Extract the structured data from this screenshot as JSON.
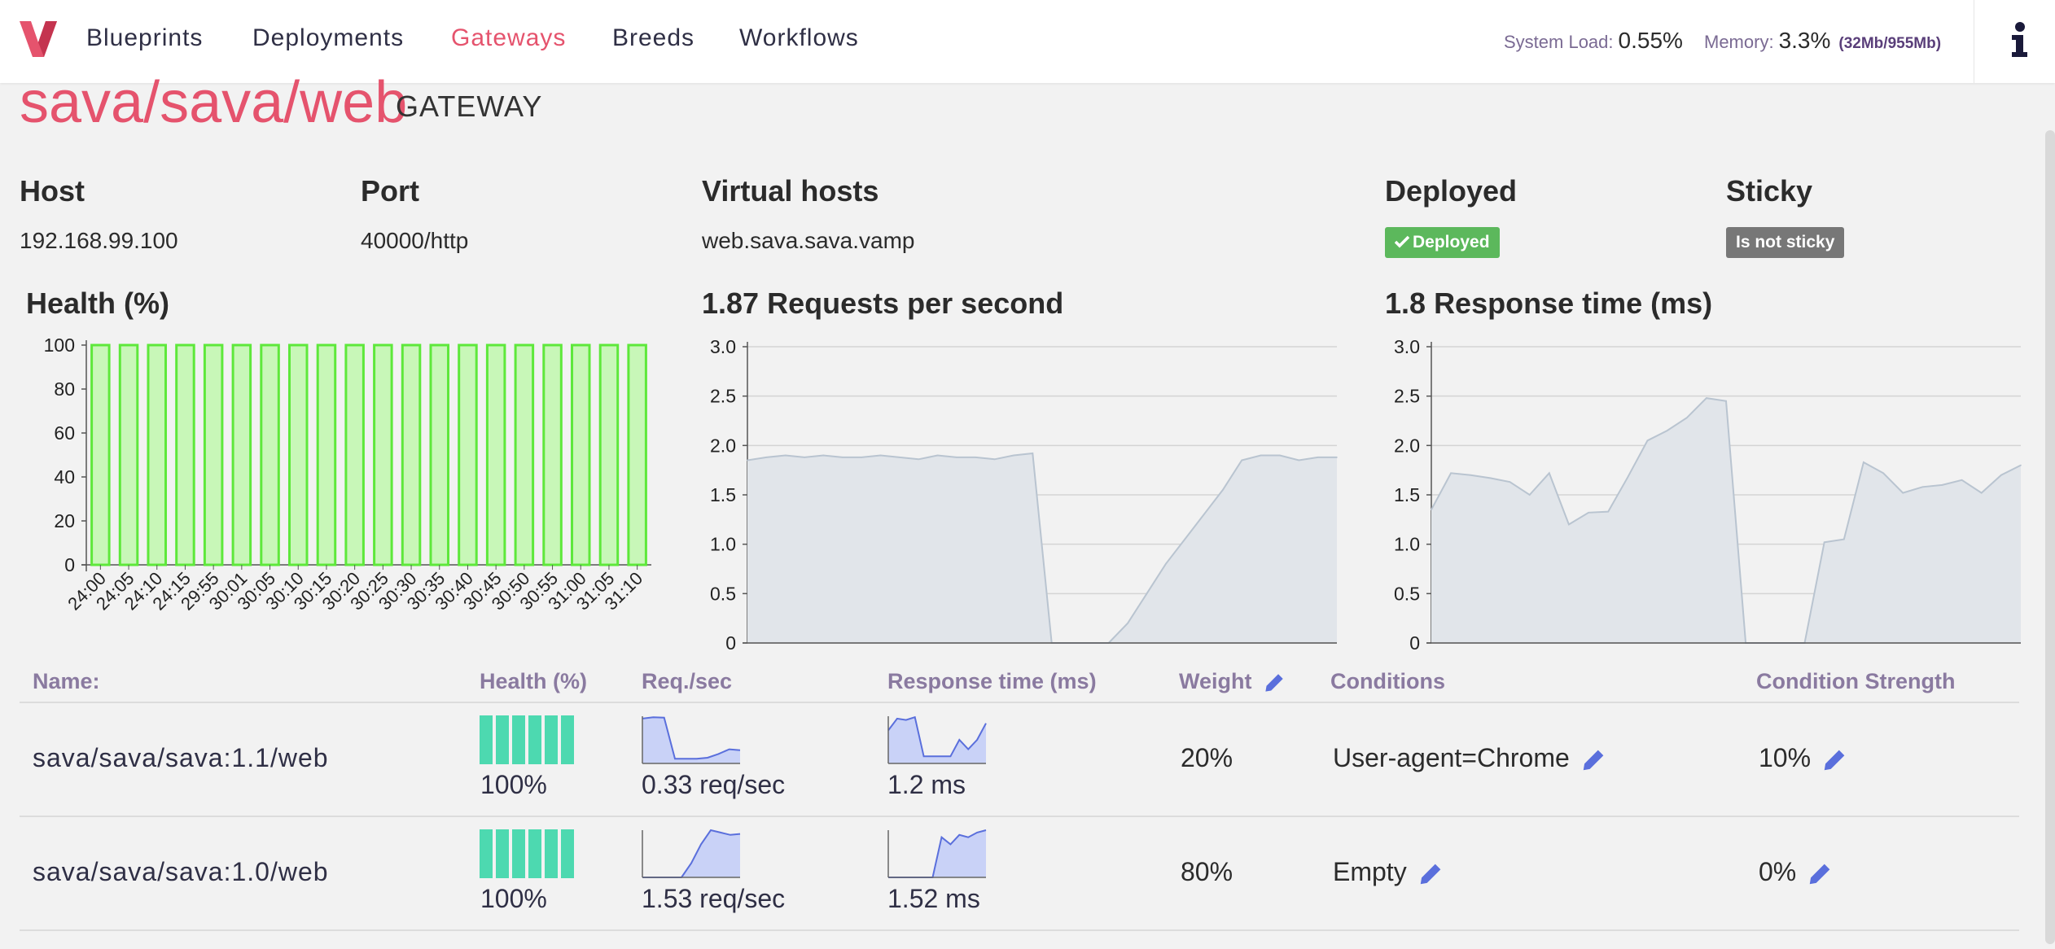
{
  "nav": {
    "items": [
      {
        "label": "Blueprints",
        "active": false
      },
      {
        "label": "Deployments",
        "active": false
      },
      {
        "label": "Gateways",
        "active": true
      },
      {
        "label": "Breeds",
        "active": false
      },
      {
        "label": "Workflows",
        "active": false
      }
    ],
    "system_load_label": "System Load:",
    "system_load_value": "0.55%",
    "memory_label": "Memory:",
    "memory_value": "3.3%",
    "memory_detail": "(32Mb/955Mb)",
    "icons": {
      "logo": "vamp-logo-icon",
      "info": "info-icon"
    },
    "accent_color": "#e5536d"
  },
  "page": {
    "title": "sava/sava/web",
    "subtitle": "GATEWAY"
  },
  "info": {
    "host_label": "Host",
    "host_value": "192.168.99.100",
    "port_label": "Port",
    "port_value": "40000/http",
    "virtual_hosts_label": "Virtual hosts",
    "virtual_hosts_value": "web.sava.sava.vamp",
    "deployed_label": "Deployed",
    "deployed_badge": "Deployed",
    "sticky_label": "Sticky",
    "sticky_badge": "Is not sticky",
    "badge_colors": {
      "deployed": "#5cb85c",
      "sticky": "#777777"
    }
  },
  "chart_data": [
    {
      "type": "bar",
      "title": "Health (%)",
      "categories": [
        "24:00",
        "24:05",
        "24:10",
        "24:15",
        "29:55",
        "30:01",
        "30:05",
        "30:10",
        "30:15",
        "30:20",
        "30:25",
        "30:30",
        "30:35",
        "30:40",
        "30:45",
        "30:50",
        "30:55",
        "31:00",
        "31:05",
        "31:10"
      ],
      "values": [
        100,
        100,
        100,
        100,
        100,
        100,
        100,
        100,
        100,
        100,
        100,
        100,
        100,
        100,
        100,
        100,
        100,
        100,
        100,
        100
      ],
      "ylim": [
        0,
        100
      ],
      "yticks": [
        "100",
        "80",
        "60",
        "40",
        "20",
        "0"
      ],
      "colors": {
        "fill": "#c8f7b8",
        "stroke": "#5ee83b"
      }
    },
    {
      "type": "area",
      "title_value": "1.87",
      "title_text": "Requests per second",
      "y": [
        1.85,
        1.88,
        1.9,
        1.88,
        1.9,
        1.88,
        1.88,
        1.9,
        1.88,
        1.86,
        1.9,
        1.88,
        1.88,
        1.86,
        1.9,
        1.92,
        0.0,
        0.0,
        0.0,
        0.0,
        0.2,
        0.5,
        0.8,
        1.05,
        1.3,
        1.55,
        1.85,
        1.9,
        1.9,
        1.85,
        1.88,
        1.88
      ],
      "ylim": [
        0,
        3.0
      ],
      "yticks": [
        "3.0",
        "2.5",
        "2.0",
        "1.5",
        "1.0",
        "0.5",
        "0"
      ],
      "grid": true,
      "colors": {
        "fill": "#e1e5ea",
        "stroke": "#b9c4d0"
      }
    },
    {
      "type": "area",
      "title_value": "1.8",
      "title_text": "Response time (ms)",
      "y": [
        1.35,
        1.72,
        1.7,
        1.67,
        1.63,
        1.5,
        1.72,
        1.2,
        1.32,
        1.33,
        1.68,
        2.05,
        2.15,
        2.28,
        2.48,
        2.45,
        0.0,
        0.0,
        0.0,
        0.0,
        1.02,
        1.05,
        1.83,
        1.72,
        1.52,
        1.58,
        1.6,
        1.65,
        1.52,
        1.7,
        1.8
      ],
      "ylim": [
        0,
        3.0
      ],
      "yticks": [
        "3.0",
        "2.5",
        "2.0",
        "1.5",
        "1.0",
        "0.5",
        "0"
      ],
      "grid": true,
      "colors": {
        "fill": "#e1e5ea",
        "stroke": "#b9c4d0"
      }
    }
  ],
  "table": {
    "headers": {
      "name": "Name:",
      "health": "Health (%)",
      "req": "Req./sec",
      "response": "Response time (ms)",
      "weight": "Weight",
      "conditions": "Conditions",
      "strength": "Condition Strength"
    },
    "rows": [
      {
        "name": "sava/sava/sava:1.1/web",
        "health": "100%",
        "req": "0.33 req/sec",
        "response": "1.2 ms",
        "weight": "20%",
        "condition": "User-agent=Chrome",
        "strength": "10%",
        "health_bars": [
          100,
          100,
          100,
          100,
          100,
          100
        ],
        "req_spark": [
          0.95,
          0.98,
          0.97,
          0.1,
          0.1,
          0.1,
          0.12,
          0.2,
          0.3,
          0.28
        ],
        "resp_spark": [
          0.7,
          0.95,
          0.92,
          0.98,
          0.15,
          0.15,
          0.15,
          0.15,
          0.5,
          0.3,
          0.5,
          0.85
        ]
      },
      {
        "name": "sava/sava/sava:1.0/web",
        "health": "100%",
        "req": "1.53 req/sec",
        "response": "1.52 ms",
        "weight": "80%",
        "condition": "Empty",
        "strength": "0%",
        "health_bars": [
          100,
          100,
          100,
          100,
          100,
          100
        ],
        "req_spark": [
          0.0,
          0.0,
          0.0,
          0.0,
          0.0,
          0.3,
          0.7,
          1.0,
          0.95,
          0.9,
          0.92
        ],
        "resp_spark": [
          0.0,
          0.0,
          0.0,
          0.0,
          0.0,
          0.0,
          0.85,
          0.7,
          0.9,
          0.85,
          0.95,
          1.0
        ]
      }
    ],
    "colors": {
      "health_bar": "#4dd9b0",
      "spark_fill": "#c9d2f7",
      "spark_stroke": "#5a6fdc",
      "edit_icon": "#5a6fdc"
    },
    "icons": {
      "edit": "pencil-icon"
    }
  }
}
